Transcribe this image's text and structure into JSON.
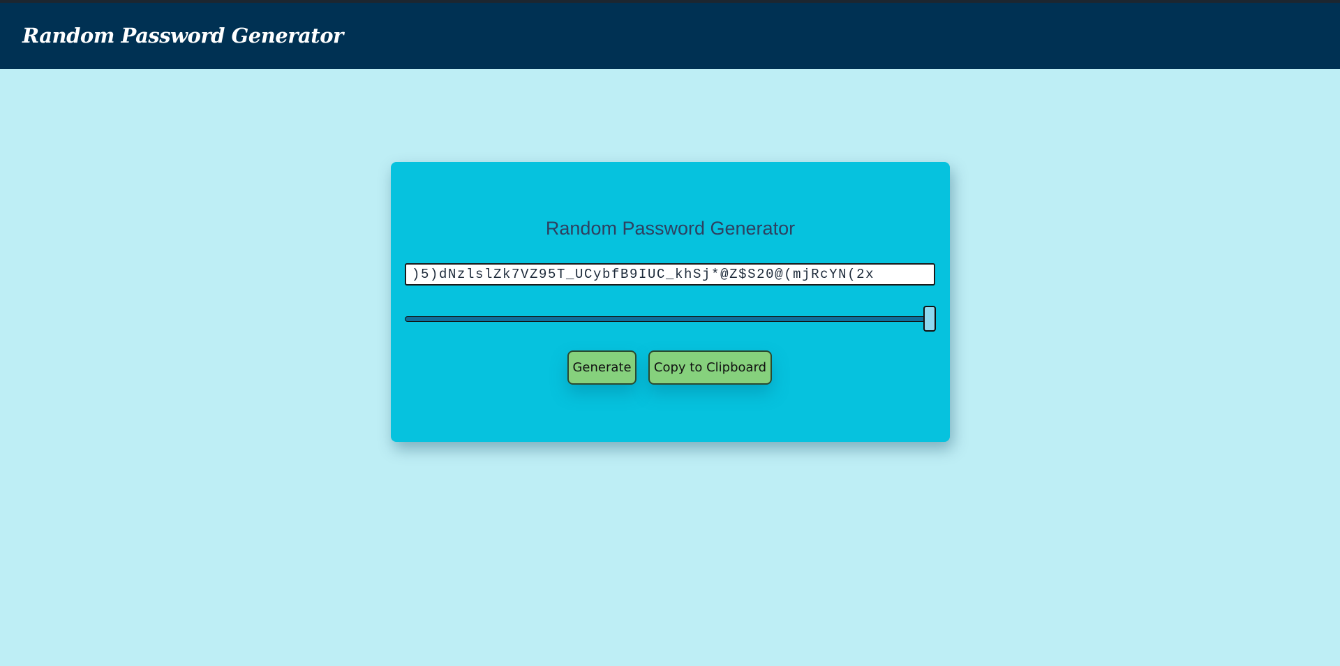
{
  "header": {
    "title": "Random Password Generator"
  },
  "card": {
    "title": "Random Password Generator",
    "password_value": ")5)dNzlslZk7VZ95T_UCybfB9IUC_khSj*@Z$S20@(mjRcYN(2x",
    "length_slider": {
      "level_fraction": 0.99
    },
    "generate_label": "Generate",
    "copy_label": "Copy to Clipboard"
  },
  "colors": {
    "page_background": "#beeef5",
    "header_background": "#003153",
    "card_background": "#06c2de",
    "button_background": "#86d17d",
    "slider_track": "#0f6e9a",
    "slider_thumb": "#8fd8ef"
  }
}
